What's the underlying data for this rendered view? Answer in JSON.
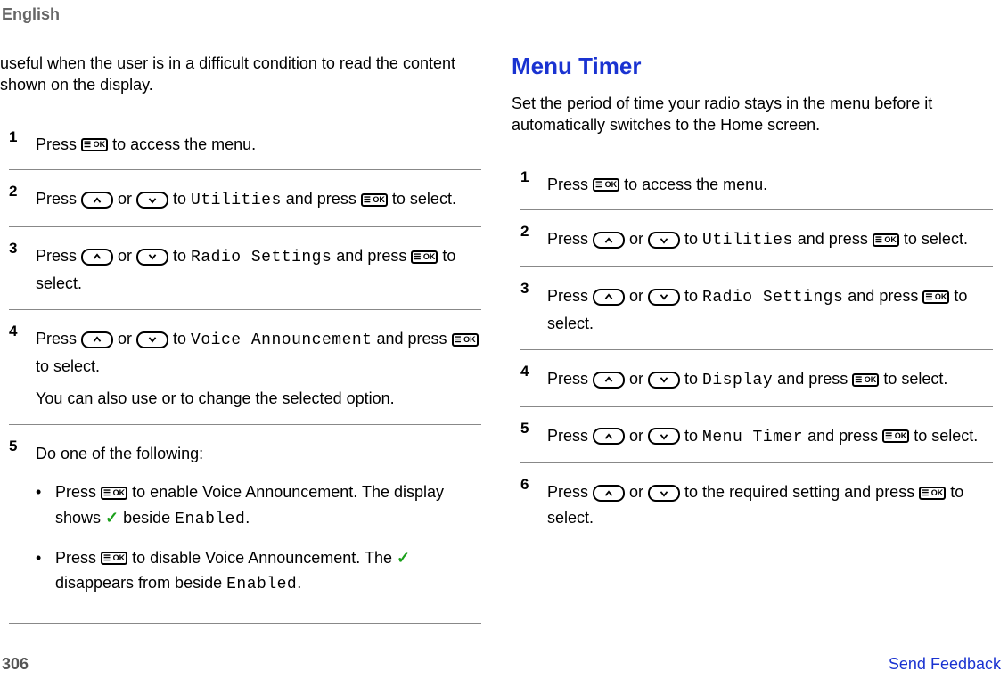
{
  "header_language": "English",
  "left": {
    "intro": "useful when the user is in a difficult condition to read the content shown on the display.",
    "steps": [
      {
        "num": "1",
        "parts": [
          {
            "t": "Press ",
            "k": "text"
          },
          {
            "k": "ok"
          },
          {
            "t": " to access the menu.",
            "k": "text"
          }
        ]
      },
      {
        "num": "2",
        "parts": [
          {
            "t": "Press ",
            "k": "text"
          },
          {
            "k": "up"
          },
          {
            "t": " or ",
            "k": "text"
          },
          {
            "k": "down"
          },
          {
            "t": " to ",
            "k": "text"
          },
          {
            "t": "Utilities",
            "k": "lcd"
          },
          {
            "t": " and press ",
            "k": "text"
          },
          {
            "k": "ok"
          },
          {
            "t": " to select.",
            "k": "text"
          }
        ]
      },
      {
        "num": "3",
        "parts": [
          {
            "t": "Press ",
            "k": "text"
          },
          {
            "k": "up"
          },
          {
            "t": " or ",
            "k": "text"
          },
          {
            "k": "down"
          },
          {
            "t": " to ",
            "k": "text"
          },
          {
            "t": "Radio Settings",
            "k": "lcd"
          },
          {
            "t": " and press ",
            "k": "text"
          },
          {
            "k": "ok"
          },
          {
            "t": " to select.",
            "k": "text"
          }
        ]
      },
      {
        "num": "4",
        "parts": [
          {
            "t": "Press ",
            "k": "text"
          },
          {
            "k": "up"
          },
          {
            "t": " or ",
            "k": "text"
          },
          {
            "k": "down"
          },
          {
            "t": " to ",
            "k": "text"
          },
          {
            "t": "Voice Announcement",
            "k": "lcd"
          },
          {
            "t": " and press ",
            "k": "text"
          },
          {
            "k": "ok"
          },
          {
            "t": " to select.",
            "k": "text"
          }
        ],
        "extra": "You can also use or to change the selected option."
      },
      {
        "num": "5",
        "lead": "Do one of the following:",
        "bullets": [
          [
            {
              "t": "Press ",
              "k": "text"
            },
            {
              "k": "ok"
            },
            {
              "t": " to enable Voice Announcement. The display shows ",
              "k": "text"
            },
            {
              "k": "check"
            },
            {
              "t": " beside ",
              "k": "text"
            },
            {
              "t": "Enabled",
              "k": "lcd"
            },
            {
              "t": ".",
              "k": "text"
            }
          ],
          [
            {
              "t": "Press ",
              "k": "text"
            },
            {
              "k": "ok"
            },
            {
              "t": " to disable Voice Announcement. The ",
              "k": "text"
            },
            {
              "k": "check"
            },
            {
              "t": " disappears from beside ",
              "k": "text"
            },
            {
              "t": "Enabled",
              "k": "lcd"
            },
            {
              "t": ".",
              "k": "text"
            }
          ]
        ]
      }
    ]
  },
  "right": {
    "heading": "Menu Timer",
    "intro": "Set the period of time your radio stays in the menu before it automatically switches to the Home screen.",
    "steps": [
      {
        "num": "1",
        "parts": [
          {
            "t": "Press ",
            "k": "text"
          },
          {
            "k": "ok"
          },
          {
            "t": " to access the menu.",
            "k": "text"
          }
        ]
      },
      {
        "num": "2",
        "parts": [
          {
            "t": "Press ",
            "k": "text"
          },
          {
            "k": "up"
          },
          {
            "t": " or ",
            "k": "text"
          },
          {
            "k": "down"
          },
          {
            "t": " to ",
            "k": "text"
          },
          {
            "t": "Utilities",
            "k": "lcd"
          },
          {
            "t": " and press ",
            "k": "text"
          },
          {
            "k": "ok"
          },
          {
            "t": " to select.",
            "k": "text"
          }
        ]
      },
      {
        "num": "3",
        "parts": [
          {
            "t": "Press ",
            "k": "text"
          },
          {
            "k": "up"
          },
          {
            "t": " or ",
            "k": "text"
          },
          {
            "k": "down"
          },
          {
            "t": " to ",
            "k": "text"
          },
          {
            "t": "Radio Settings",
            "k": "lcd"
          },
          {
            "t": " and press ",
            "k": "text"
          },
          {
            "k": "ok"
          },
          {
            "t": " to select.",
            "k": "text"
          }
        ]
      },
      {
        "num": "4",
        "parts": [
          {
            "t": "Press ",
            "k": "text"
          },
          {
            "k": "up"
          },
          {
            "t": " or ",
            "k": "text"
          },
          {
            "k": "down"
          },
          {
            "t": " to ",
            "k": "text"
          },
          {
            "t": "Display",
            "k": "lcd"
          },
          {
            "t": " and press ",
            "k": "text"
          },
          {
            "k": "ok"
          },
          {
            "t": " to select.",
            "k": "text"
          }
        ]
      },
      {
        "num": "5",
        "parts": [
          {
            "t": "Press ",
            "k": "text"
          },
          {
            "k": "up"
          },
          {
            "t": " or ",
            "k": "text"
          },
          {
            "k": "down"
          },
          {
            "t": " to ",
            "k": "text"
          },
          {
            "t": "Menu Timer",
            "k": "lcd"
          },
          {
            "t": " and press ",
            "k": "text"
          },
          {
            "k": "ok"
          },
          {
            "t": " to select.",
            "k": "text"
          }
        ]
      },
      {
        "num": "6",
        "parts": [
          {
            "t": "Press ",
            "k": "text"
          },
          {
            "k": "up"
          },
          {
            "t": " or ",
            "k": "text"
          },
          {
            "k": "down"
          },
          {
            "t": " to the required setting and press ",
            "k": "text"
          },
          {
            "k": "ok"
          },
          {
            "t": " to select.",
            "k": "text"
          }
        ]
      }
    ]
  },
  "footer": {
    "page_number": "306",
    "feedback_label": "Send Feedback"
  }
}
